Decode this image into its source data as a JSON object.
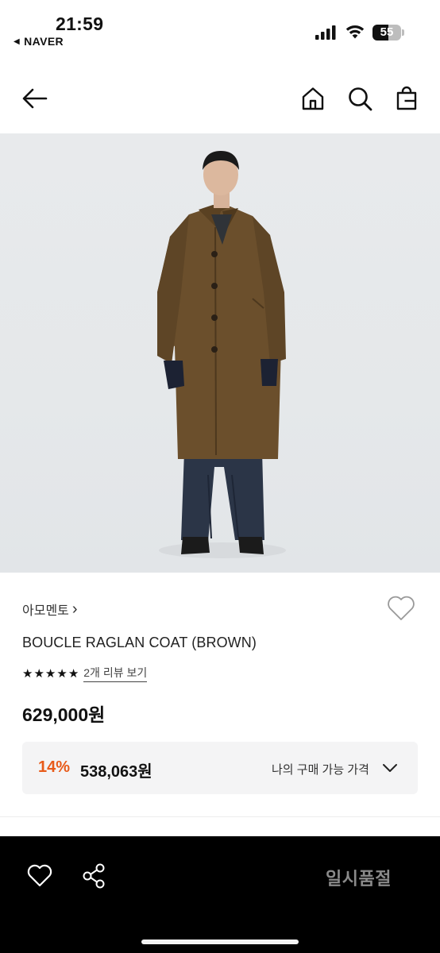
{
  "status_bar": {
    "time": "21:59",
    "back_app": "NAVER",
    "battery": "55",
    "battery_level": 0.55
  },
  "nav": {
    "back_icon": "arrow-left-icon",
    "home_icon": "home-icon",
    "search_icon": "search-icon",
    "bag_icon": "shopping-bag-icon"
  },
  "product": {
    "brand": "아모멘토",
    "brand_chevron": "›",
    "title": "BOUCLE RAGLAN COAT (BROWN)",
    "rating_stars": 5,
    "review_link": "2개 리뷰 보기",
    "price": "629,000원",
    "discount": {
      "rate": "14%",
      "price": "538,063원",
      "label": "나의 구매 가능 가격"
    }
  },
  "bottom_bar": {
    "wish_icon": "heart-icon",
    "share_icon": "share-icon",
    "status_label": "일시품절"
  },
  "colors": {
    "accent_discount": "#e85b1a",
    "image_background": "#e6e9eb",
    "bottom_bar": "#000000",
    "soldout_text": "#8a8a8a"
  }
}
